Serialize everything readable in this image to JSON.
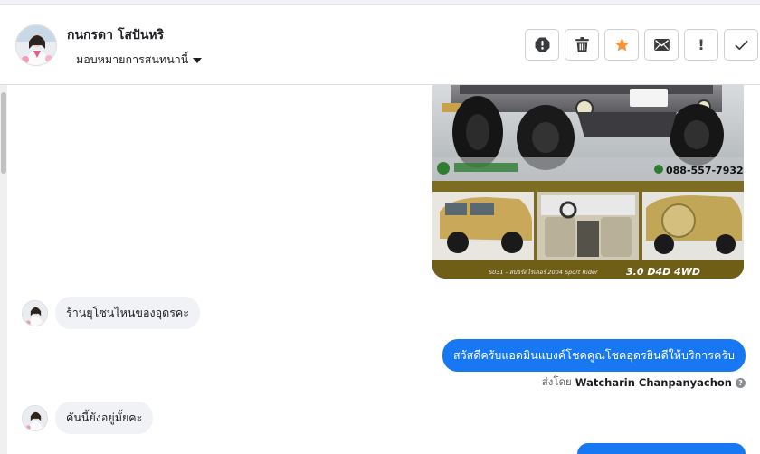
{
  "header": {
    "contact_name": "กนกรดา โสปันหริ",
    "assign_label": "มอบหมายการสนทนานี้",
    "actions": [
      {
        "name": "report-spam-icon"
      },
      {
        "name": "trash-icon"
      },
      {
        "name": "star-icon"
      },
      {
        "name": "envelope-icon"
      },
      {
        "name": "exclamation-icon",
        "text": "!"
      },
      {
        "name": "checkmark-icon"
      }
    ]
  },
  "attachment": {
    "phone": "088-557-7932",
    "model_prefix": "S031 - สปอร์ตไรเดอร์ 2004 Sport Rider",
    "model": "3.0 D4D 4WD"
  },
  "messages": [
    {
      "direction": "in",
      "text": "ร้านยุโซนไหนของอุดรคะ"
    },
    {
      "direction": "out",
      "text": "สวัสดีครับแอดมินแบงค์โชคคูณโชคอุดรยินดีให้บริการครับ"
    },
    {
      "direction": "out-meta",
      "sent_label": "ส่งโดย",
      "sender": "Watcharin Chanpanyachon"
    },
    {
      "direction": "in",
      "text": "คันนี้ยังอยู่มั้ยคะ"
    }
  ],
  "colors": {
    "accent": "#1877f2",
    "star": "#f7923a",
    "bubble_in": "#f0f2f5"
  }
}
